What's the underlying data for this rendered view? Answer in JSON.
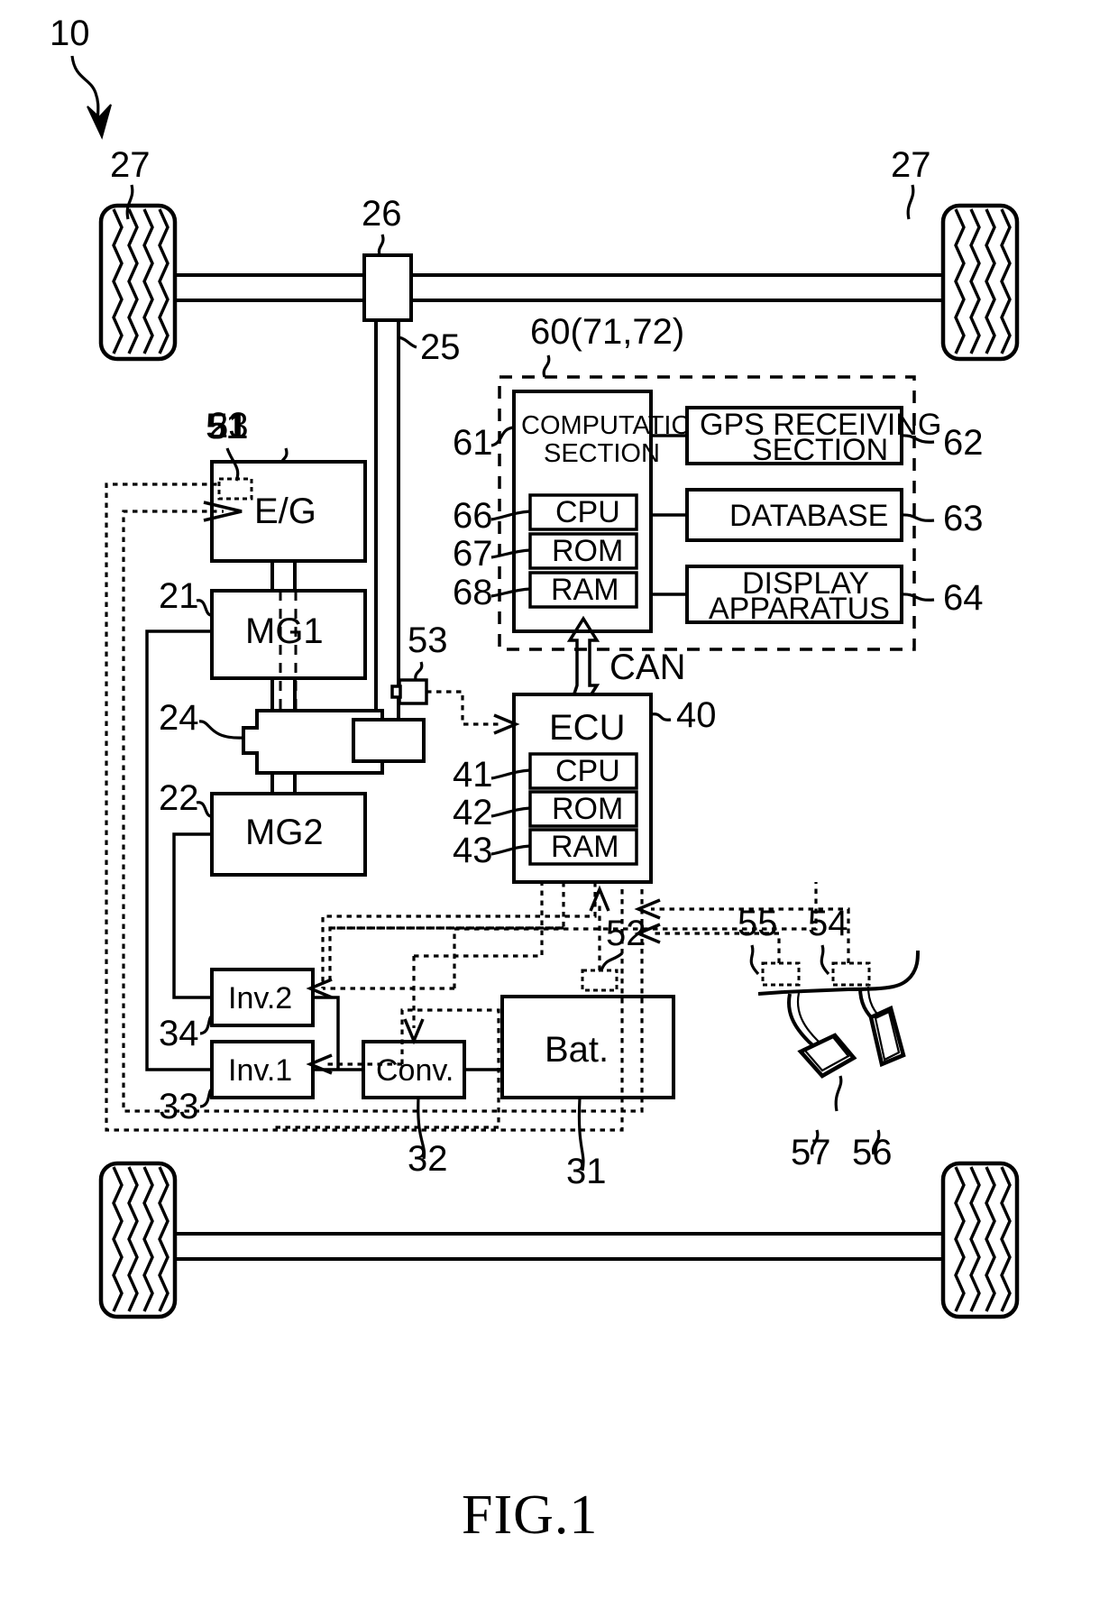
{
  "figure": {
    "caption": "FIG.1",
    "system_ref": "10"
  },
  "drivetrain": {
    "front_wheel_left_ref": "27",
    "front_wheel_right_ref": "27",
    "differential_ref": "26",
    "driveshaft_ref": "25",
    "engine_label": "E/G",
    "engine_ref": "23",
    "engine_sensor_ref": "51",
    "mg1_label": "MG1",
    "mg1_ref": "21",
    "power_split_ref": "24",
    "mg2_label": "MG2",
    "mg2_ref": "22",
    "speed_sensor_ref": "53"
  },
  "power_system": {
    "inverter2_label": "Inv.2",
    "inverter2_ref": "34",
    "inverter1_label": "Inv.1",
    "inverter1_ref": "33",
    "converter_label": "Conv.",
    "converter_ref": "32",
    "battery_label": "Bat.",
    "battery_ref": "31",
    "battery_sensor_ref": "52"
  },
  "navigation": {
    "group_ref": "60(71,72)",
    "computation_section_line1": "COMPUTATION",
    "computation_section_line2": "SECTION",
    "computation_section_ref": "61",
    "cpu_label": "CPU",
    "cpu_ref": "66",
    "rom_label": "ROM",
    "rom_ref": "67",
    "ram_label": "RAM",
    "ram_ref": "68",
    "gps_line1": "GPS RECEIVING",
    "gps_line2": "SECTION",
    "gps_ref": "62",
    "database_label": "DATABASE",
    "database_ref": "63",
    "display_line1": "DISPLAY",
    "display_line2": "APPARATUS",
    "display_ref": "64"
  },
  "ecu": {
    "label": "ECU",
    "ref": "40",
    "cpu_label": "CPU",
    "cpu_ref": "41",
    "rom_label": "ROM",
    "rom_ref": "42",
    "ram_label": "RAM",
    "ram_ref": "43",
    "bus_label": "CAN"
  },
  "pedals": {
    "brake_sensor_ref": "55",
    "accel_sensor_ref": "54",
    "brake_pedal_ref": "57",
    "accel_pedal_ref": "56"
  }
}
